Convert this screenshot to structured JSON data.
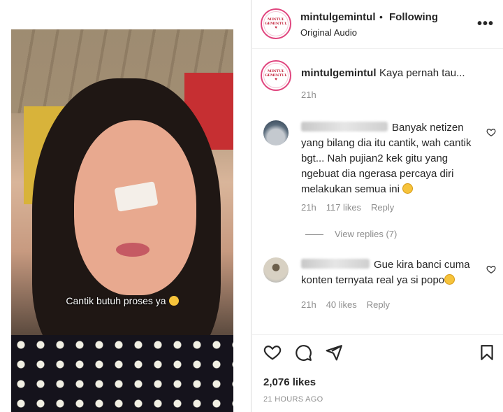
{
  "post": {
    "video_caption": "Cantik butuh proses ya",
    "author": {
      "username": "mintulgemintul",
      "logo_line1": "MINTUL",
      "logo_line2": "GEMINTUL"
    },
    "follow_dot": "•",
    "follow_status": "Following",
    "audio": "Original Audio",
    "caption": {
      "username": "mintulgemintul",
      "text": "Kaya pernah tau...",
      "time": "21h"
    },
    "comments": [
      {
        "text": "Banyak netizen yang bilang dia itu cantik, wah cantik bgt... Nah pujian2 kek gitu yang ngebuat dia ngerasa percaya diri melakukan semua ini",
        "time": "21h",
        "likes": "117 likes",
        "reply_label": "Reply",
        "view_replies": "View replies (7)"
      },
      {
        "text": "Gue kira banci cuma konten ternyata real ya si popo",
        "time": "21h",
        "likes": "40 likes",
        "reply_label": "Reply"
      }
    ],
    "likes_count": "2,076 likes",
    "posted": "21 HOURS AGO"
  },
  "icons": {
    "more": "more-options-icon",
    "like": "heart-icon",
    "comment": "comment-icon",
    "share": "paper-plane-icon",
    "save": "bookmark-icon",
    "comment_like": "heart-outline-icon"
  },
  "colors": {
    "text": "#262626",
    "secondary": "#8e8e8e",
    "story_ring": "#e0457e",
    "divider": "#efefef"
  }
}
